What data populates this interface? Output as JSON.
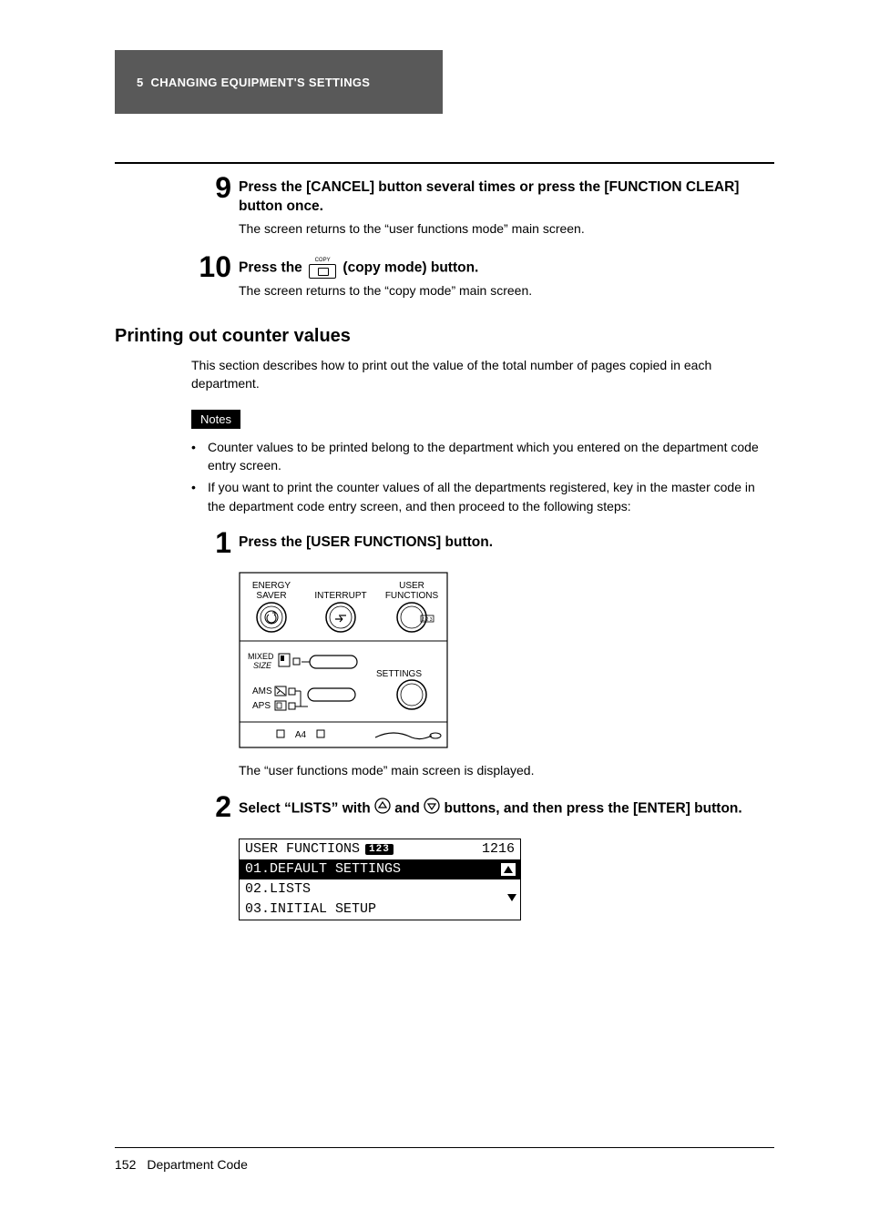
{
  "header": {
    "chapter_num": "5",
    "chapter_title": "CHANGING EQUIPMENT'S SETTINGS"
  },
  "steps_top": {
    "s9": {
      "num": "9",
      "title": "Press the [CANCEL] button several times or press the [FUNCTION CLEAR] button once.",
      "desc": "The screen returns to the “user functions mode” main screen."
    },
    "s10": {
      "num": "10",
      "title_before": "Press the ",
      "copy_label": "COPY",
      "title_after": " (copy mode) button.",
      "desc": "The screen returns to the “copy mode” main screen."
    }
  },
  "section": {
    "heading": "Printing out counter values",
    "intro": "This section describes how to print out the value of the total number of pages copied in each department."
  },
  "notes": {
    "label": "Notes",
    "items": [
      "Counter values to be printed belong to the department which you entered on the department code entry screen.",
      "If you want to print the counter values of all the departments registered, key in the master code in the department code entry screen, and then proceed to the following steps:"
    ]
  },
  "steps_section": {
    "s1": {
      "num": "1",
      "title": "Press the [USER FUNCTIONS] button.",
      "after": "The “user functions mode” main screen is displayed."
    },
    "s2": {
      "num": "2",
      "title_a": "Select “LISTS” with ",
      "title_b": " and ",
      "title_c": " buttons, and then press the [ENTER] button."
    }
  },
  "panel": {
    "labels": {
      "energy_saver_l1": "ENERGY",
      "energy_saver_l2": "SAVER",
      "interrupt": "INTERRUPT",
      "user_functions_l1": "USER",
      "user_functions_l2": "FUNCTIONS",
      "mixed_l1": "MIXED",
      "mixed_l2": "SIZE",
      "ams": "AMS",
      "aps": "APS",
      "settings": "SETTINGS",
      "a4": "A4"
    }
  },
  "lcd": {
    "title": "USER FUNCTIONS",
    "badge": "123",
    "count": "1216",
    "rows": [
      "01.DEFAULT SETTINGS",
      "02.LISTS",
      "03.INITIAL SETUP"
    ]
  },
  "footer": {
    "page": "152",
    "label": "Department Code"
  }
}
